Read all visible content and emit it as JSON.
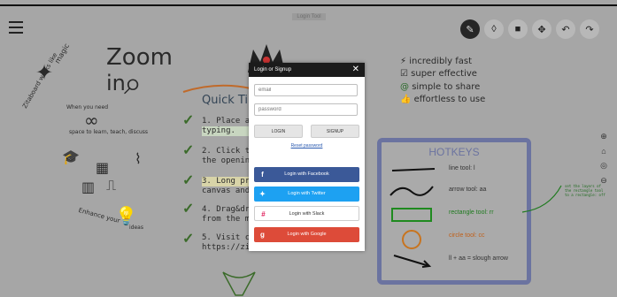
{
  "top": {
    "center_tag": "Login Tool"
  },
  "toolbar": {
    "tools": [
      "pen-icon",
      "eraser-icon",
      "shape-icon",
      "move-icon",
      "undo-icon",
      "redo-icon"
    ]
  },
  "canvas": {
    "zoom_title": "Zoom",
    "zoom_in": "in",
    "magic_text": "magic",
    "works_like": "Zitaboard works like",
    "when_need": "When you need",
    "space_text": "space to learn, teach, discuss",
    "enhance_text": "Enhance your",
    "ideas_text": "ideas",
    "quick_tips": "Quick Tips",
    "tips": [
      {
        "n": "1. Place a",
        "rest": "typing."
      },
      {
        "n": "2. Click t",
        "rest": "the openin"
      },
      {
        "n": "3. Long pr",
        "rest": "canvas and"
      },
      {
        "n": "4. Drag&dr",
        "rest": "from the m"
      },
      {
        "n": "5. Visit c",
        "rest": "https://zi"
      }
    ],
    "features": [
      "incredibly fast",
      "super effective",
      "simple to share",
      "effortless to use"
    ],
    "hotkeys": {
      "title": "HOTKEYS",
      "rows": [
        "line tool: l",
        "arrow tool: aa",
        "rectangle tool: rr",
        "circle tool: cc",
        "ll + aa = slough arrow"
      ]
    },
    "side_note": "set the layers of the rectangle tool to a rectangle: off"
  },
  "modal": {
    "title": "Login or Signup",
    "close": "✕",
    "email_placeholder": "email",
    "password_placeholder": "password",
    "login": "LOGIN",
    "signup": "SIGNUP",
    "reset": "Reset password",
    "facebook": "Login with Facebook",
    "twitter": "Login with Twitter",
    "slack": "Login with Slack",
    "google": "Login with Google"
  }
}
